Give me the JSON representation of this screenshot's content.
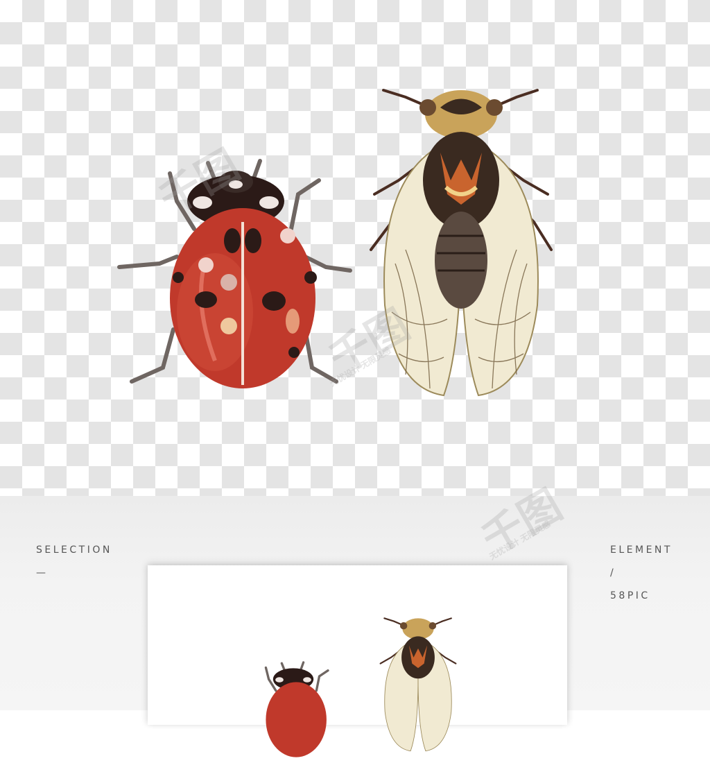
{
  "labels": {
    "selection": "SELECTION",
    "selection_dash": "—",
    "element": "ELEMENT",
    "element_slash": "/",
    "brand": "58PIC"
  },
  "watermark": {
    "logo_text": "千图",
    "tagline": "无忧设计 无限灵感"
  },
  "colors": {
    "checker_light": "#ffffff",
    "checker_dark": "#e4e4e4",
    "ladybug_red": "#c0392b",
    "ladybug_black": "#2b1a17",
    "cicada_wing": "#f1ead2",
    "cicada_body": "#3a2a20",
    "cicada_accent": "#c9642e"
  },
  "icons": [
    "ladybug-illustration",
    "cicada-illustration",
    "watermark-logo-icon"
  ]
}
